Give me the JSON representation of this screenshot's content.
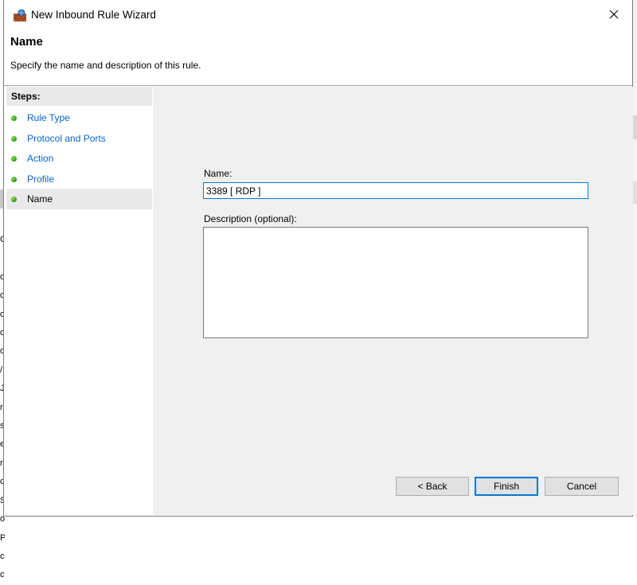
{
  "window": {
    "title": "New Inbound Rule Wizard",
    "close_glyph": "✕"
  },
  "header": {
    "title": "Name",
    "subtitle": "Specify the name and description of this rule."
  },
  "steps": {
    "heading": "Steps:",
    "items": [
      {
        "label": "Rule Type",
        "current": false
      },
      {
        "label": "Protocol and Ports",
        "current": false
      },
      {
        "label": "Action",
        "current": false
      },
      {
        "label": "Profile",
        "current": false
      },
      {
        "label": "Name",
        "current": true
      }
    ]
  },
  "form": {
    "name_label": "Name:",
    "name_value": "3389 [ RDP ]",
    "description_label": "Description (optional):",
    "description_value": ""
  },
  "buttons": {
    "back": "< Back",
    "finish": "Finish",
    "cancel": "Cancel"
  },
  "background": {
    "left_edge_letters": [
      "C",
      "",
      "o",
      "o",
      "o",
      "o",
      "o",
      "/",
      "J",
      "r",
      "s",
      "e",
      "r",
      "c",
      "S",
      "o",
      "P",
      "c",
      "c"
    ]
  },
  "colors": {
    "link": "#0066cc",
    "focus_border": "#0078d7",
    "steps_highlight": "#e9e9e9",
    "content_bg": "#f0f0f0"
  }
}
